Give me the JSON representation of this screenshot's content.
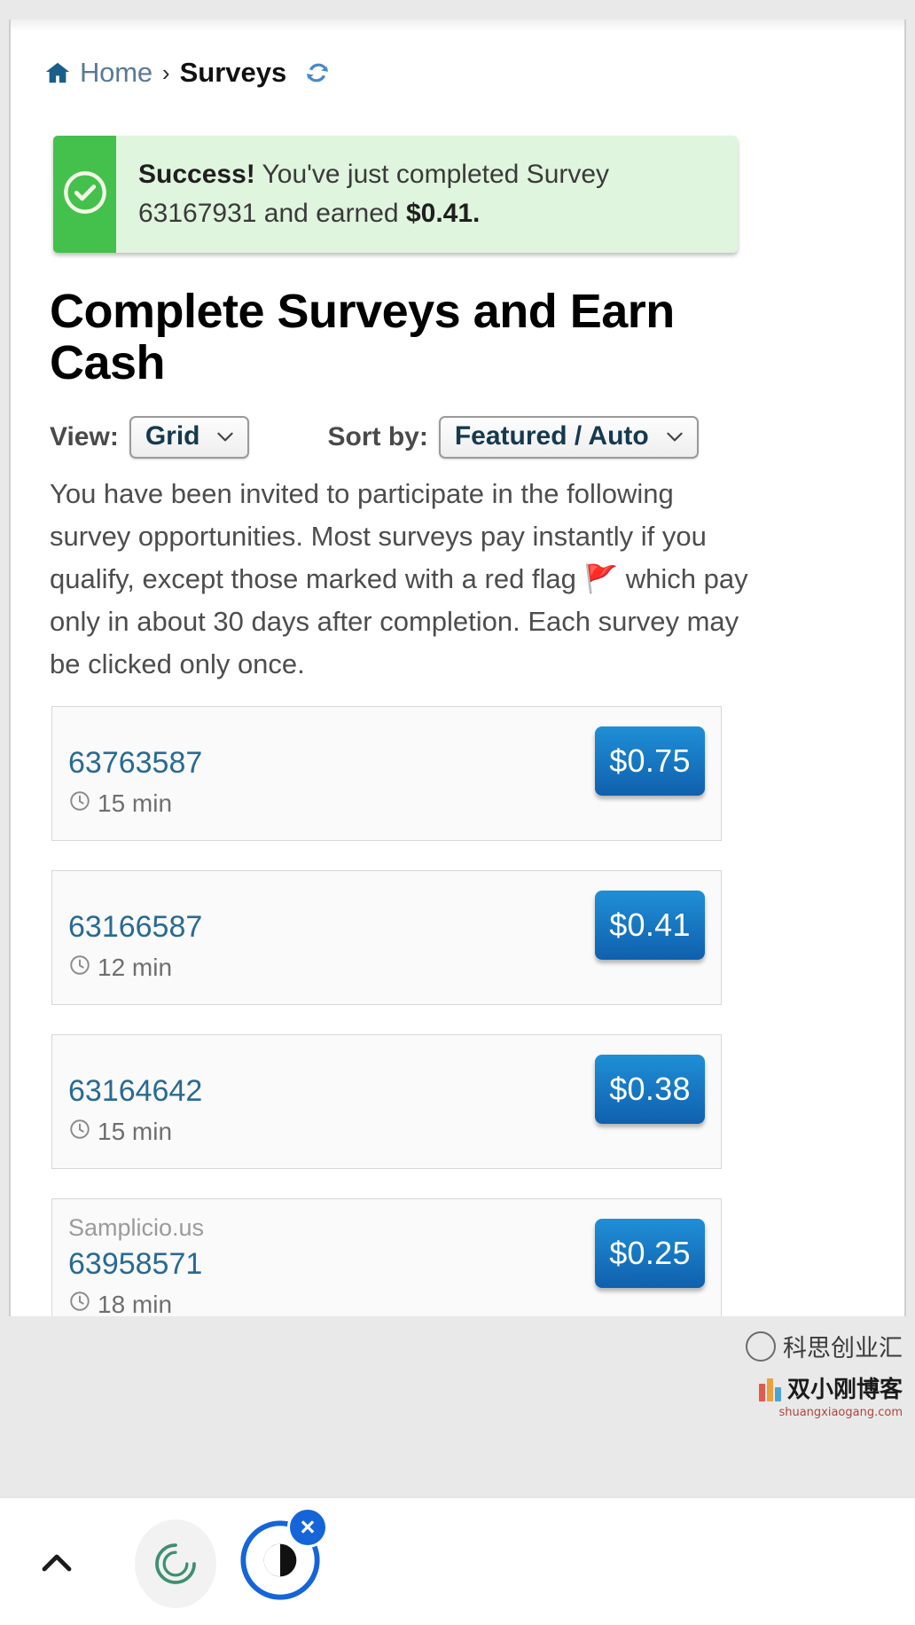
{
  "breadcrumb": {
    "home_label": "Home",
    "separator": "›",
    "current_label": "Surveys",
    "home_icon": "home-icon",
    "refresh_icon": "refresh-icon"
  },
  "alert": {
    "icon": "check-circle-icon",
    "strong_text": "Success!",
    "message": " You've just completed Survey 63167931 and earned ",
    "amount": "$0.41.",
    "bar_color": "#44c14c",
    "background_color": "#dff5dd"
  },
  "page_title": "Complete Surveys and Earn Cash",
  "controls": {
    "view_label": "View:",
    "view_value": "Grid",
    "sort_label": "Sort by:",
    "sort_value": "Featured / Auto",
    "caret_icon": "chevron-down-icon"
  },
  "intro_text": "You have been invited to participate in the following survey opportunities. Most surveys pay instantly if you qualify, except those marked with a red flag 🚩 which pay only in about 30 days after completion. Each survey may be clicked only once.",
  "cards": [
    {
      "source": "",
      "id": "63763587",
      "duration": "15 min",
      "price": "$0.75",
      "clock_icon": "clock-icon"
    },
    {
      "source": "",
      "id": "63166587",
      "duration": "12 min",
      "price": "$0.41",
      "clock_icon": "clock-icon"
    },
    {
      "source": "",
      "id": "63164642",
      "duration": "15 min",
      "price": "$0.38",
      "clock_icon": "clock-icon"
    },
    {
      "source": "Samplicio.us",
      "id": "63958571",
      "duration": "18 min",
      "price": "$0.25",
      "clock_icon": "clock-icon"
    }
  ],
  "bottom_bar": {
    "chevron_icon": "chevron-up-icon",
    "spinner_icon": "loading-spinner-icon",
    "globe_icon": "globe-icon",
    "close_badge": "×"
  },
  "watermark": {
    "account_name": "科思创业汇",
    "blog_name": "双小刚博客",
    "url": "shuangxiaogang.com"
  },
  "colors": {
    "link_blue": "#2a6a92",
    "button_blue": "#1f8fd6",
    "success_green": "#44c14c"
  }
}
